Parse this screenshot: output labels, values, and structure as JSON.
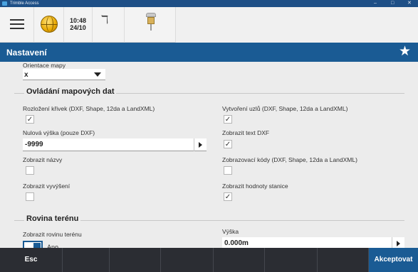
{
  "window": {
    "title": "Trimble Access",
    "controls": [
      "–",
      "□",
      "✕"
    ]
  },
  "statusbar": {
    "time": "10:48",
    "date": "24/10"
  },
  "header": {
    "title": "Nastavení"
  },
  "map_orientation": {
    "label": "Orientace mapy",
    "value": "x"
  },
  "map_data_group": {
    "title": "Ovládání mapových dat",
    "curve_layout": {
      "label": "Rozložení křivek (DXF, Shape, 12da a LandXML)",
      "checked": true
    },
    "create_nodes": {
      "label": "Vytvoření uzlů (DXF, Shape, 12da a LandXML)",
      "checked": true
    },
    "zero_height": {
      "label": "Nulová výška (pouze DXF)",
      "value": "-9999"
    },
    "show_dxf_text": {
      "label": "Zobrazit text DXF",
      "checked": true
    },
    "show_names": {
      "label": "Zobrazit názvy",
      "checked": false
    },
    "show_codes": {
      "label": "Zobrazovací kódy (DXF, Shape, 12da a LandXML)",
      "checked": false
    },
    "show_elevations": {
      "label": "Zobrazit vyvýšení",
      "checked": false
    },
    "show_station_values": {
      "label": "Zobrazit hodnoty stanice",
      "checked": true
    }
  },
  "terrain_group": {
    "title": "Rovina terénu",
    "show_plane": {
      "label": "Zobrazit rovinu terénu",
      "state": "Ano"
    },
    "height": {
      "label": "Výška",
      "value": "0.000m"
    }
  },
  "bottombar": {
    "esc": "Esc",
    "accept": "Akceptovat"
  },
  "colors": {
    "brand_blue": "#1a5b94",
    "bottombar": "#2b2d33"
  }
}
